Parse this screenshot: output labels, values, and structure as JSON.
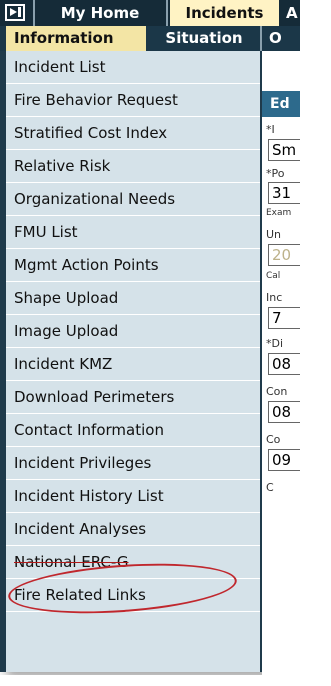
{
  "nav": {
    "tabs": [
      {
        "label": "My Home"
      },
      {
        "label": "Incidents"
      },
      {
        "label": "A"
      }
    ]
  },
  "subnav": {
    "tabs": [
      {
        "label": "Information"
      },
      {
        "label": "Situation"
      },
      {
        "label": "O"
      }
    ]
  },
  "menu": {
    "items": [
      {
        "label": "Incident List"
      },
      {
        "label": "Fire Behavior Request"
      },
      {
        "label": "Stratified Cost Index"
      },
      {
        "label": "Relative Risk"
      },
      {
        "label": "Organizational Needs"
      },
      {
        "label": "FMU List"
      },
      {
        "label": "Mgmt Action Points"
      },
      {
        "label": "Shape Upload"
      },
      {
        "label": "Image Upload"
      },
      {
        "label": "Incident KMZ"
      },
      {
        "label": "Download Perimeters"
      },
      {
        "label": "Contact Information"
      },
      {
        "label": "Incident Privileges"
      },
      {
        "label": "Incident History List"
      },
      {
        "label": "Incident Analyses"
      },
      {
        "label": "National ERC-G"
      },
      {
        "label": "Fire Related Links"
      }
    ]
  },
  "content_edge": {
    "header": "Ed",
    "label1": "*I",
    "value1": "Sm",
    "label2": "*Po",
    "value2": "31",
    "label3": "Exam",
    "label4": "Un",
    "value3": "20",
    "label5": "Cal",
    "label6": "Inc",
    "value4": "7",
    "label7": "*Di",
    "value5": "08",
    "label8": "Con",
    "value6": "08",
    "label9": "Co",
    "value7": "09",
    "label10": "C"
  },
  "colors": {
    "nav_bg": "#152b38",
    "active_tab": "#fff3c4",
    "menu_bg": "#d5e2e9",
    "annotation": "#c0272d"
  }
}
